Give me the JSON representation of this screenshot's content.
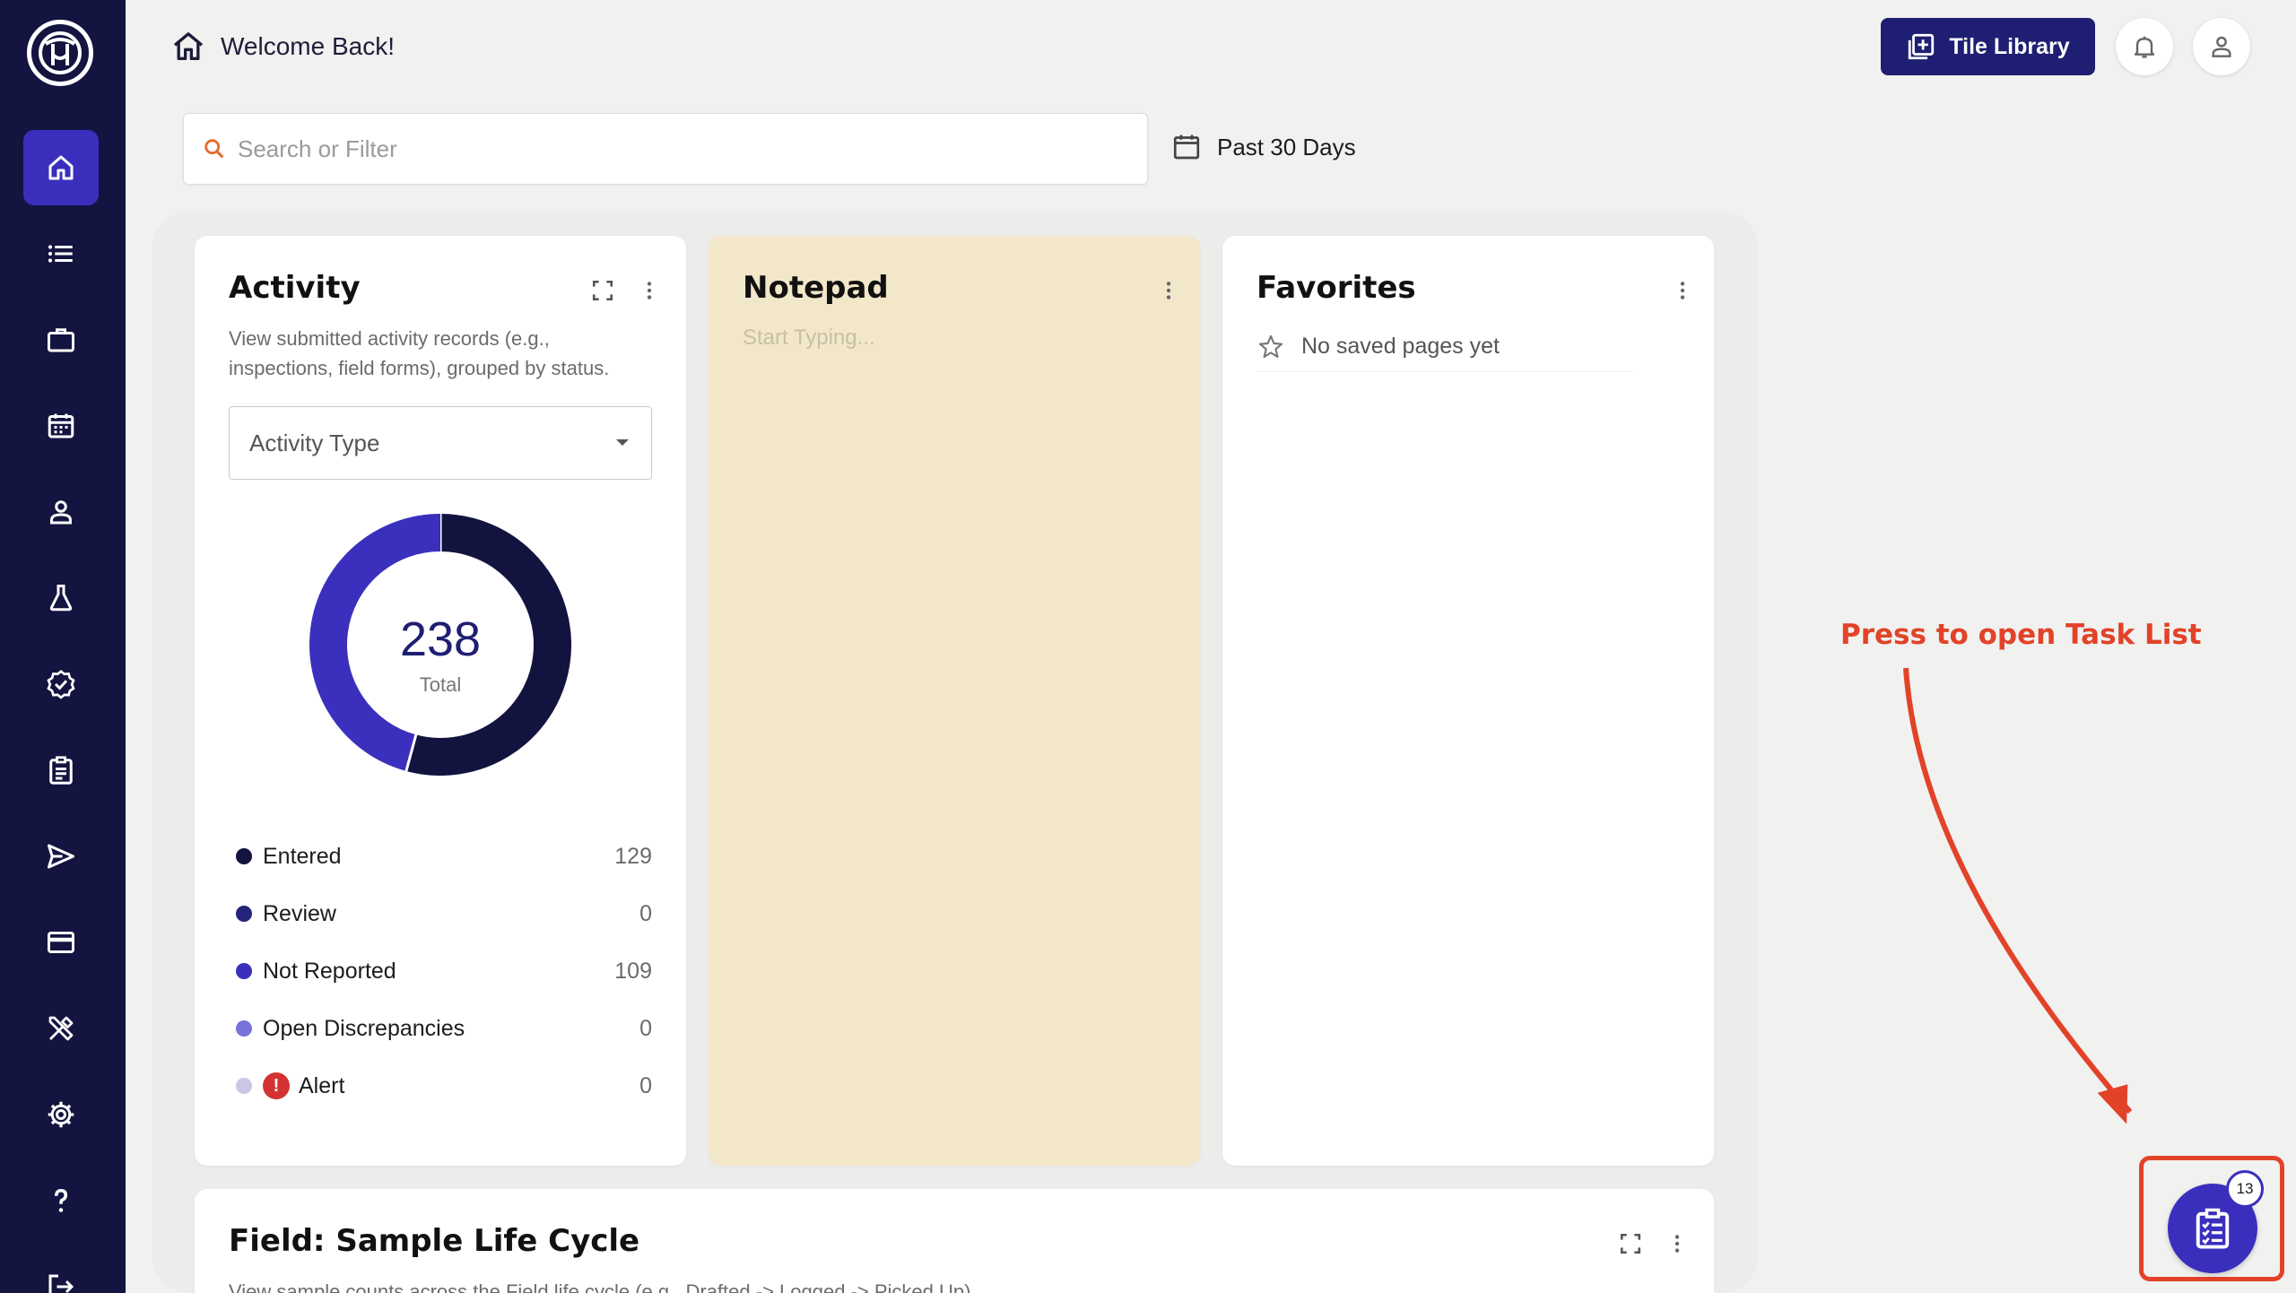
{
  "header": {
    "welcome": "Welcome Back!",
    "tile_library_label": "Tile Library"
  },
  "search": {
    "placeholder": "Search or Filter"
  },
  "date_filter": {
    "label": "Past 30 Days"
  },
  "sidebar": {
    "items": [
      {
        "icon": "home-icon",
        "active": true
      },
      {
        "icon": "list-icon"
      },
      {
        "icon": "briefcase-icon"
      },
      {
        "icon": "calendar-icon"
      },
      {
        "icon": "user-icon"
      },
      {
        "icon": "flask-icon"
      },
      {
        "icon": "verified-badge-icon"
      },
      {
        "icon": "clipboard-icon"
      },
      {
        "icon": "send-icon"
      },
      {
        "icon": "credit-card-icon"
      },
      {
        "icon": "tools-icon"
      },
      {
        "icon": "gear-icon"
      },
      {
        "icon": "help-icon"
      },
      {
        "icon": "logout-icon"
      }
    ]
  },
  "activity": {
    "title": "Activity",
    "description": "View submitted activity records (e.g., inspections, field forms), grouped by status.",
    "select_label": "Activity Type",
    "total": "238",
    "total_label": "Total",
    "legend": [
      {
        "label": "Entered",
        "value": "129",
        "color": "#131340"
      },
      {
        "label": "Review",
        "value": "0",
        "color": "#24247a"
      },
      {
        "label": "Not Reported",
        "value": "109",
        "color": "#3b30bd"
      },
      {
        "label": "Open Discrepancies",
        "value": "0",
        "color": "#7a72db"
      },
      {
        "label": "Alert",
        "value": "0",
        "color": "#c9c6e6"
      }
    ]
  },
  "chart_data": {
    "type": "pie",
    "categories": [
      "Entered",
      "Review",
      "Not Reported",
      "Open Discrepancies",
      "Alert"
    ],
    "values": [
      129,
      0,
      109,
      0,
      0
    ],
    "title": "",
    "total": 238
  },
  "notepad": {
    "title": "Notepad",
    "placeholder": "Start Typing..."
  },
  "favorites": {
    "title": "Favorites",
    "empty_text": "No saved pages yet"
  },
  "life_cycle": {
    "title": "Field: Sample Life Cycle",
    "description": "View sample counts across the Field life cycle (e.g., Drafted -> Logged -> Picked Up)."
  },
  "annotation": {
    "hint": "Press to open Task List"
  },
  "task_list": {
    "count": "13"
  }
}
